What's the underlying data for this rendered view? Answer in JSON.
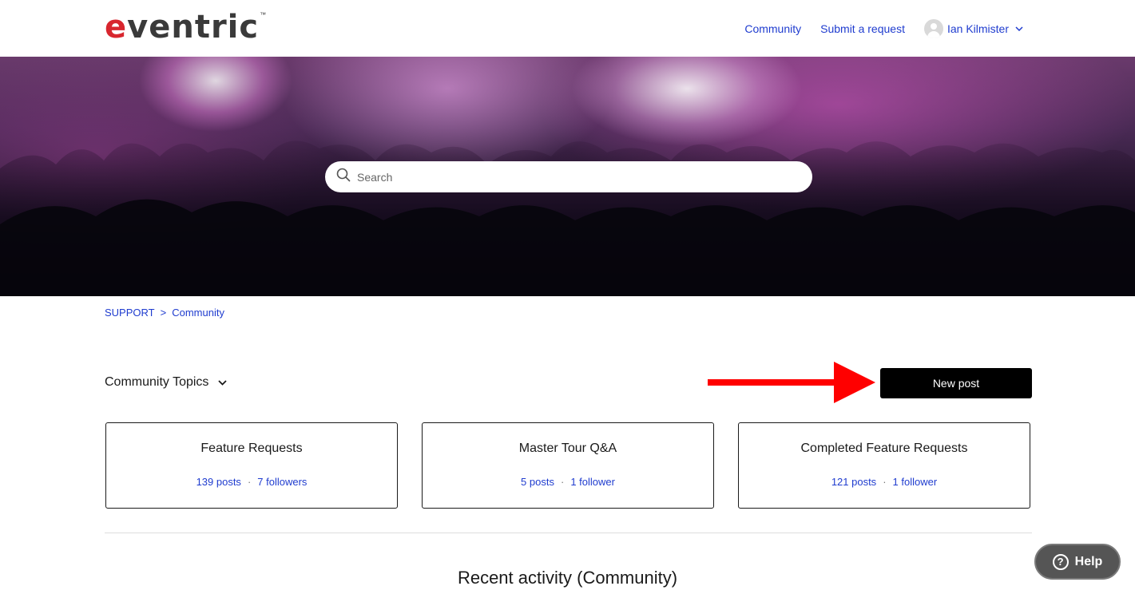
{
  "header": {
    "logo": "eventric",
    "logo_tm": "™",
    "nav": {
      "community": "Community",
      "submit_request": "Submit a request",
      "user_name": "Ian Kilmister",
      "user_chevron": "⌄"
    }
  },
  "hero": {
    "search_placeholder": "Search"
  },
  "breadcrumb": {
    "items": [
      "SUPPORT",
      "Community"
    ],
    "separator": ">"
  },
  "topics": {
    "title": "Community Topics",
    "chevron": "⌄",
    "new_post_label": "New post",
    "cards": [
      {
        "title": "Feature Requests",
        "posts": "139 posts",
        "followers": "7 followers"
      },
      {
        "title": "Master Tour Q&A",
        "posts": "5 posts",
        "followers": "1 follower"
      },
      {
        "title": "Completed Feature Requests",
        "posts": "121 posts",
        "followers": "1 follower"
      }
    ],
    "meta_separator": "·"
  },
  "recent_activity": {
    "title": "Recent activity (Community)"
  },
  "help": {
    "label": "Help",
    "icon_glyph": "?"
  },
  "colors": {
    "link": "#1f3ccf",
    "brand_red": "#d8262e",
    "arrow_red": "#ff0000",
    "button_black": "#000000"
  }
}
